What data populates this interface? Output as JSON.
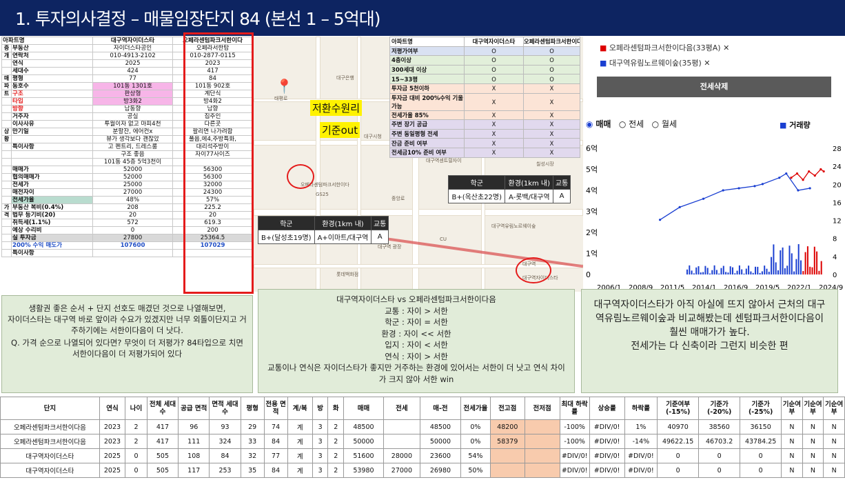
{
  "header": {
    "title": "1. 투자의사결정 – 매물임장단지 84 (본선 1 – 5억대)"
  },
  "compare": {
    "col_head": [
      "아파트명",
      "대구역자이더스타",
      "오페라센텀파크서한이다"
    ],
    "rows": [
      [
        "중",
        "부동산",
        "자이더스타공인",
        "오페라서한탐"
      ],
      [
        "개",
        "연락처",
        "010-4913-2102",
        "010-2877-0115"
      ],
      [
        "",
        "연식",
        "2025",
        "2023"
      ],
      [
        "",
        "세대수",
        "424",
        "417"
      ],
      [
        "매",
        "평형",
        "77",
        "84"
      ],
      [
        "파",
        "동호수",
        "101동 1301호",
        "101동 902호"
      ],
      [
        "트",
        "구조",
        "판상형",
        "계단식"
      ],
      [
        "",
        "타입",
        "방3화2",
        "방4화2"
      ],
      [
        "",
        "방향",
        "남동향",
        "남향"
      ],
      [
        "",
        "거주자",
        "공실",
        "집주인"
      ],
      [
        "",
        "이사사유",
        "투월이자 없고 마피4천",
        "다른곳"
      ],
      [
        "상",
        "만기일",
        "분할잔, 에어컨x",
        "팔리면 나가려함"
      ],
      [
        "황",
        "",
        "뷰가 생각보다 괜찮았",
        "풀옵,에4,주방특화,"
      ],
      [
        "",
        "특이사항",
        "고 펜트리, 드레스룸",
        "대리석주방이"
      ],
      [
        "",
        "",
        "구조 좋음",
        "자이77사이즈"
      ],
      [
        "",
        "",
        "101동 45층 5억3천이",
        ""
      ],
      [
        "",
        "매매가",
        "52000",
        "56300"
      ],
      [
        "",
        "협의매매가",
        "52000",
        "56300"
      ],
      [
        "",
        "전세가",
        "25000",
        "32000"
      ],
      [
        "",
        "매전자이",
        "27000",
        "24300"
      ],
      [
        "",
        "전세가율",
        "48%",
        "57%"
      ],
      [
        "가",
        "부동산 복비(0.4%)",
        "208",
        "225.2"
      ],
      [
        "격",
        "법무 등기비(20)",
        "20",
        "20"
      ],
      [
        "",
        "취득세(1.1%)",
        "572",
        "619.3"
      ],
      [
        "",
        "예상 수리비",
        "0",
        "200"
      ],
      [
        "",
        "실 투자금",
        "27800",
        "25364.5"
      ],
      [
        "",
        "200% 수익 매도가",
        "107600",
        "107029"
      ],
      [
        "",
        "특이사항",
        "",
        ""
      ]
    ]
  },
  "criteria": {
    "head": [
      "아파트명",
      "대구역자이더스타",
      "오페라센텀파크서한이다"
    ],
    "rows": [
      [
        "저평가여부",
        "O",
        "O"
      ],
      [
        "4층이상",
        "O",
        "O"
      ],
      [
        "300세대 이상",
        "O",
        "O"
      ],
      [
        "15~33평",
        "O",
        "O"
      ],
      [
        "투자금 5천이하",
        "X",
        "X"
      ],
      [
        "투자금 대비 200%수익 기울 가능",
        "X",
        "X"
      ],
      [
        "전세가율 85%",
        "X",
        "X"
      ],
      [
        "주변 장기 공급",
        "X",
        "X"
      ],
      [
        "주변 동일평형 전세",
        "X",
        "X"
      ],
      [
        "잔금 준비 여부",
        "X",
        "X"
      ],
      [
        "전세금10% 준비 여부",
        "X",
        "X"
      ]
    ]
  },
  "map": {
    "stamp1": "저환수원리",
    "stamp2": "기준out",
    "labels": [
      "대구역",
      "대구역자이더스타",
      "오페라센텀파크서한이다",
      "대구역센트럴자이",
      "칠성시장",
      "대구역유림노르웨이숲",
      "태평로",
      "북성로",
      "대구은행",
      "대구시청",
      "칠성동",
      "중앙로",
      "경상감영공원",
      "GS25",
      "CU",
      "칠성교",
      "신천",
      "대구역 광장",
      "롯데백화점",
      "대구제일중학교"
    ],
    "school1": {
      "h": [
        "학군",
        "환경(1km 내)",
        "교통"
      ],
      "v": [
        "B+(달성초19명)",
        "A+이마트/대구역",
        "A"
      ]
    },
    "school2": {
      "h": [
        "학군",
        "환경(1km 내)",
        "교통"
      ],
      "v": [
        "B+(옥산초22명)",
        "A-롯백/대구역",
        "A"
      ]
    }
  },
  "right": {
    "leg1": "오페라센텀파크서한이다음(33평A)",
    "leg2": "대구역유림노르웨이숲(35평)",
    "btn": "전세삭제",
    "radio": [
      "매매",
      "전세",
      "월세"
    ],
    "vol": "거래량",
    "yticks": [
      "6억",
      "5억",
      "4억",
      "3억",
      "2억",
      "1억",
      "0"
    ],
    "rticks": [
      "28",
      "24",
      "20",
      "16",
      "12",
      "8",
      "4",
      "0"
    ],
    "xticks": [
      "2006/1",
      "2008/9",
      "2011/5",
      "2014/1",
      "2016/9",
      "2019/5",
      "2022/1",
      "2024/9"
    ]
  },
  "notes": {
    "n1": [
      "생활권 좋은 순서 + 단지 선호도 매겼던 것으로 나열해보면,",
      "자이더스타는 대구역 바로 앞이라 수요가 있겠지만 너무 외톨이단지고 거주하기에는 서한이다음이 더 낫다.",
      "Q. 가격 순으로 나열되어 있다면? 무엇이 더 저평가? 84타입으로 치면 서한이다음이 더 저평가되어 있다"
    ],
    "n2": [
      "대구역자이더스타 vs 오페라센텀파크서한이다음",
      "교통 : 자이 > 서한",
      "학군 : 자이 = 서한",
      "환경 : 자이 << 서한",
      "입지 : 자이 < 서한",
      "연식 : 자이 > 서한",
      "교통이나 연식은 자이더스타가 좋지만 거주하는 환경에 있어서는 서한이 더 낫고 연식 차이가 크지 않아 서한 win"
    ],
    "n3": [
      "대구역자이더스타가 아직 아실에 뜨지 않아서 근처의 대구역유림노르웨이숲과 비교해봤는데 센텀파크서한이다음이 훨씬 매매가가 높다.",
      "전세가는 다 신축이라 그런지 비슷한 편"
    ]
  },
  "bottom": {
    "head": [
      "단지",
      "연식",
      "나이",
      "전체 세대수",
      "공급 면적",
      "면적 세대수",
      "평형",
      "전용 면적",
      "계/복",
      "방",
      "화",
      "매매",
      "전세",
      "매-전",
      "전세가율",
      "전고점",
      "전저점",
      "최대 하락률",
      "상승률",
      "하락률",
      "기준여부 (-15%)",
      "기준가 (-20%)",
      "기준가 (-25%)",
      "기순여부",
      "기순여부",
      "기순여부"
    ],
    "rows": [
      [
        "오페라센텀파크서한이다음",
        "2023",
        "2",
        "417",
        "96",
        "93",
        "29",
        "74",
        "계",
        "3",
        "2",
        "48500",
        "",
        "48500",
        "0%",
        "48200",
        "",
        "-100%",
        "#DIV/0!",
        "1%",
        "40970",
        "38560",
        "36150",
        "N",
        "N",
        "N"
      ],
      [
        "오페라센텀파크서한이다음",
        "2023",
        "2",
        "417",
        "111",
        "324",
        "33",
        "84",
        "계",
        "3",
        "2",
        "50000",
        "",
        "50000",
        "0%",
        "58379",
        "",
        "-100%",
        "#DIV/0!",
        "-14%",
        "49622.15",
        "46703.2",
        "43784.25",
        "N",
        "N",
        "N"
      ],
      [
        "대구역자이더스타",
        "2025",
        "0",
        "505",
        "108",
        "84",
        "32",
        "77",
        "계",
        "3",
        "2",
        "51600",
        "28000",
        "23600",
        "54%",
        "",
        "",
        "#DIV/0!",
        "#DIV/0!",
        "#DIV/0!",
        "0",
        "0",
        "0",
        "N",
        "N",
        "N"
      ],
      [
        "대구역자이더스타",
        "2025",
        "0",
        "505",
        "117",
        "253",
        "35",
        "84",
        "계",
        "3",
        "2",
        "53980",
        "27000",
        "26980",
        "50%",
        "",
        "",
        "#DIV/0!",
        "#DIV/0!",
        "#DIV/0!",
        "0",
        "0",
        "0",
        "N",
        "N",
        "N"
      ]
    ]
  },
  "chart_data": {
    "type": "line",
    "title": "",
    "xlabel": "",
    "ylabel": "",
    "x_ticks": [
      "2006/1",
      "2008/9",
      "2011/5",
      "2014/1",
      "2016/9",
      "2019/5",
      "2022/1",
      "2024/9"
    ],
    "ylim": [
      0,
      6
    ],
    "series": [
      {
        "name": "오페라센텀파크서한이다음(33평A)",
        "x": [
          "2022/6",
          "2022/12",
          "2023/6",
          "2023/12",
          "2024/6",
          "2024/12",
          "2025/3"
        ],
        "y": [
          4.6,
          4.8,
          4.5,
          4.9,
          4.7,
          5.0,
          4.9
        ]
      },
      {
        "name": "대구역유림노르웨이숲(35평)",
        "x": [
          "2011/5",
          "2013/1",
          "2015/1",
          "2016/9",
          "2018/1",
          "2019/5",
          "2020/1",
          "2021/6",
          "2022/1",
          "2023/1",
          "2024/1"
        ],
        "y": [
          2.6,
          3.2,
          3.6,
          4.0,
          4.1,
          4.2,
          4.3,
          4.6,
          4.8,
          4.0,
          4.1
        ]
      }
    ]
  }
}
